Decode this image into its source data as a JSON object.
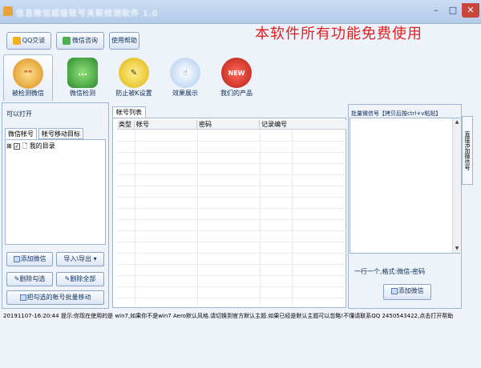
{
  "window": {
    "title": "信息微信超级账号关联检测软件 1.0",
    "min_label": "–",
    "max_label": "□",
    "close_label": "✕"
  },
  "header": {
    "qq_button": "QQ交谈",
    "wechat_button": "微信咨询",
    "help_button": "使用帮助",
    "banner": "本软件所有功能免费使用"
  },
  "toolbar": {
    "items": [
      {
        "label": "被检测微信",
        "badge": "\"\""
      },
      {
        "label": "微信检测",
        "badge": "..."
      },
      {
        "label": "防止被K设置",
        "badge": "✎"
      },
      {
        "label": "效果展示",
        "badge": "☝"
      },
      {
        "label": "我们的产品",
        "badge": "NEW"
      }
    ]
  },
  "left": {
    "header": "可以打开",
    "tabs": [
      "微信帐号",
      "帐号移动目标"
    ],
    "tree_root": "我的目录",
    "buttons": {
      "add": "添加微信",
      "import_export": "导入\\导出",
      "delete_checked": "删除勾选",
      "delete_all": "删除全部",
      "move_checked": "把勾选的帐号批量移动"
    }
  },
  "middle": {
    "tab": "帐号列表",
    "columns": [
      "类型",
      "帐号",
      "密码",
      "记录编号"
    ]
  },
  "right": {
    "header": "批量微信号【拷贝后按ctrl+v粘贴】",
    "format_hint": "一行一个,格式:微信-密码",
    "add_button": "添加微信",
    "side_tab": "直接添加微信号"
  },
  "status": {
    "timestamp": "20191107-16:20:44",
    "message": "提示:你现在使用的是 win7,如果你不是win7 Aero默认风格.请切换到官方默认主题.如果已经是默认主题可以忽略!不懂请联系QQ 2450543422,点击打开帮助"
  }
}
